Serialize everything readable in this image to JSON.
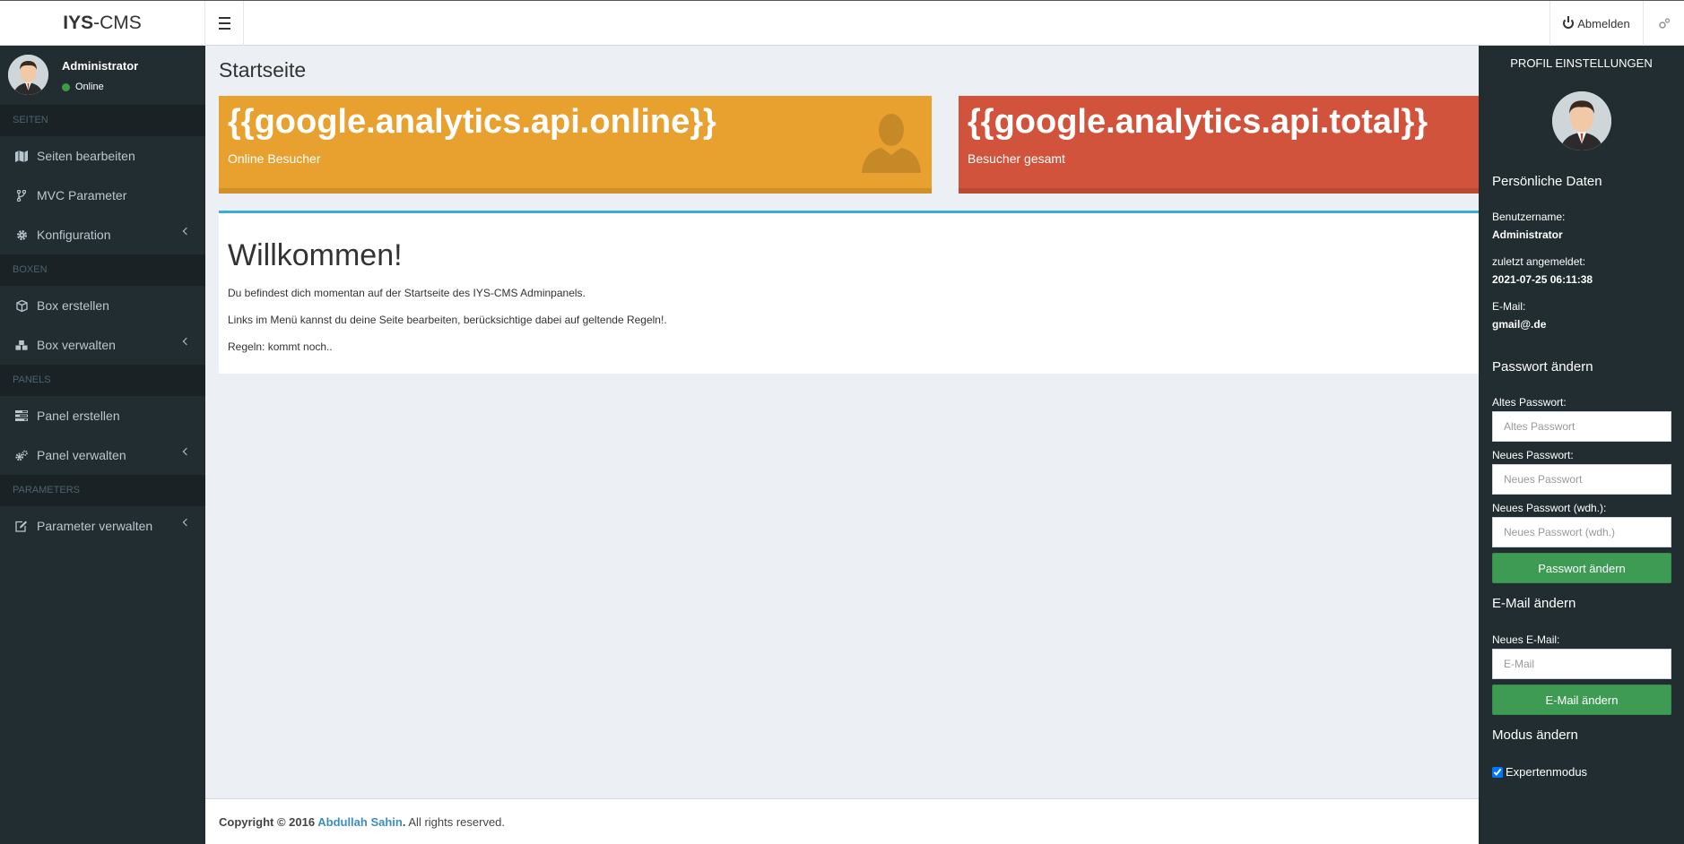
{
  "app": {
    "logo_bold": "IYS",
    "logo_rest": "-CMS"
  },
  "header": {
    "logout_label": "Abmelden",
    "gears_icon": "gears-icon",
    "menu_icon": "hamburger-icon"
  },
  "sidebar": {
    "user": {
      "name": "Administrator",
      "status": "Online"
    },
    "sections": [
      {
        "title": "SEITEN",
        "items": [
          {
            "label": "Seiten bearbeiten",
            "icon": "map-icon"
          },
          {
            "label": "MVC Parameter",
            "icon": "code-fork-icon"
          },
          {
            "label": "Konfiguration",
            "icon": "gear-icon",
            "has_submenu": true
          }
        ]
      },
      {
        "title": "BOXEN",
        "items": [
          {
            "label": "Box erstellen",
            "icon": "cube-icon"
          },
          {
            "label": "Box verwalten",
            "icon": "cubes-icon",
            "has_submenu": true
          }
        ]
      },
      {
        "title": "PANELS",
        "items": [
          {
            "label": "Panel erstellen",
            "icon": "tasks-icon"
          },
          {
            "label": "Panel verwalten",
            "icon": "gears-icon",
            "has_submenu": true
          }
        ]
      },
      {
        "title": "PARAMETERS",
        "items": [
          {
            "label": "Parameter verwalten",
            "icon": "edit-icon",
            "has_submenu": true
          }
        ]
      }
    ]
  },
  "main": {
    "title": "Startseite",
    "info_boxes": [
      {
        "number": "{{google.analytics.api.online}}",
        "label": "Online Besucher",
        "color": "#e8a12f",
        "icon": "user-icon"
      },
      {
        "number": "{{google.analytics.api.total}}",
        "label": "Besucher gesamt",
        "color": "#d1533c"
      }
    ],
    "welcome": {
      "heading": "Willkommen!",
      "lines": [
        "Du befindest dich momentan auf der Startseite des IYS-CMS Adminpanels.",
        "Links im Menü kannst du deine Seite bearbeiten, berücksichtige dabei auf geltende Regeln!.",
        "Regeln: kommt noch.."
      ]
    }
  },
  "footer": {
    "prefix": "Copyright © 2016 ",
    "author": "Abdullah Sahin",
    "suffix": ". All rights reserved."
  },
  "profile_panel": {
    "title": "PROFIL EINSTELLUNGEN",
    "personal_heading": "Persönliche Daten",
    "username_label": "Benutzername:",
    "username_value": "Administrator",
    "last_login_label": "zuletzt angemeldet:",
    "last_login_value": "2021-07-25 06:11:38",
    "email_label": "E-Mail:",
    "email_value": "gmail@.de",
    "password_heading": "Passwort ändern",
    "old_pw_label": "Altes Passwort:",
    "old_pw_placeholder": "Altes Passwort",
    "new_pw_label": "Neues Passwort:",
    "new_pw_placeholder": "Neues Passwort",
    "repeat_pw_label": "Neues Passwort (wdh.):",
    "repeat_pw_placeholder": "Neues Passwort (wdh.)",
    "change_pw_button": "Passwort ändern",
    "email_heading": "E-Mail ändern",
    "new_email_label": "Neues E-Mail:",
    "new_email_placeholder": "E-Mail",
    "change_email_button": "E-Mail ändern",
    "mode_heading": "Modus ändern",
    "expert_mode_label": "Expertenmodus",
    "expert_mode_checked": true
  }
}
